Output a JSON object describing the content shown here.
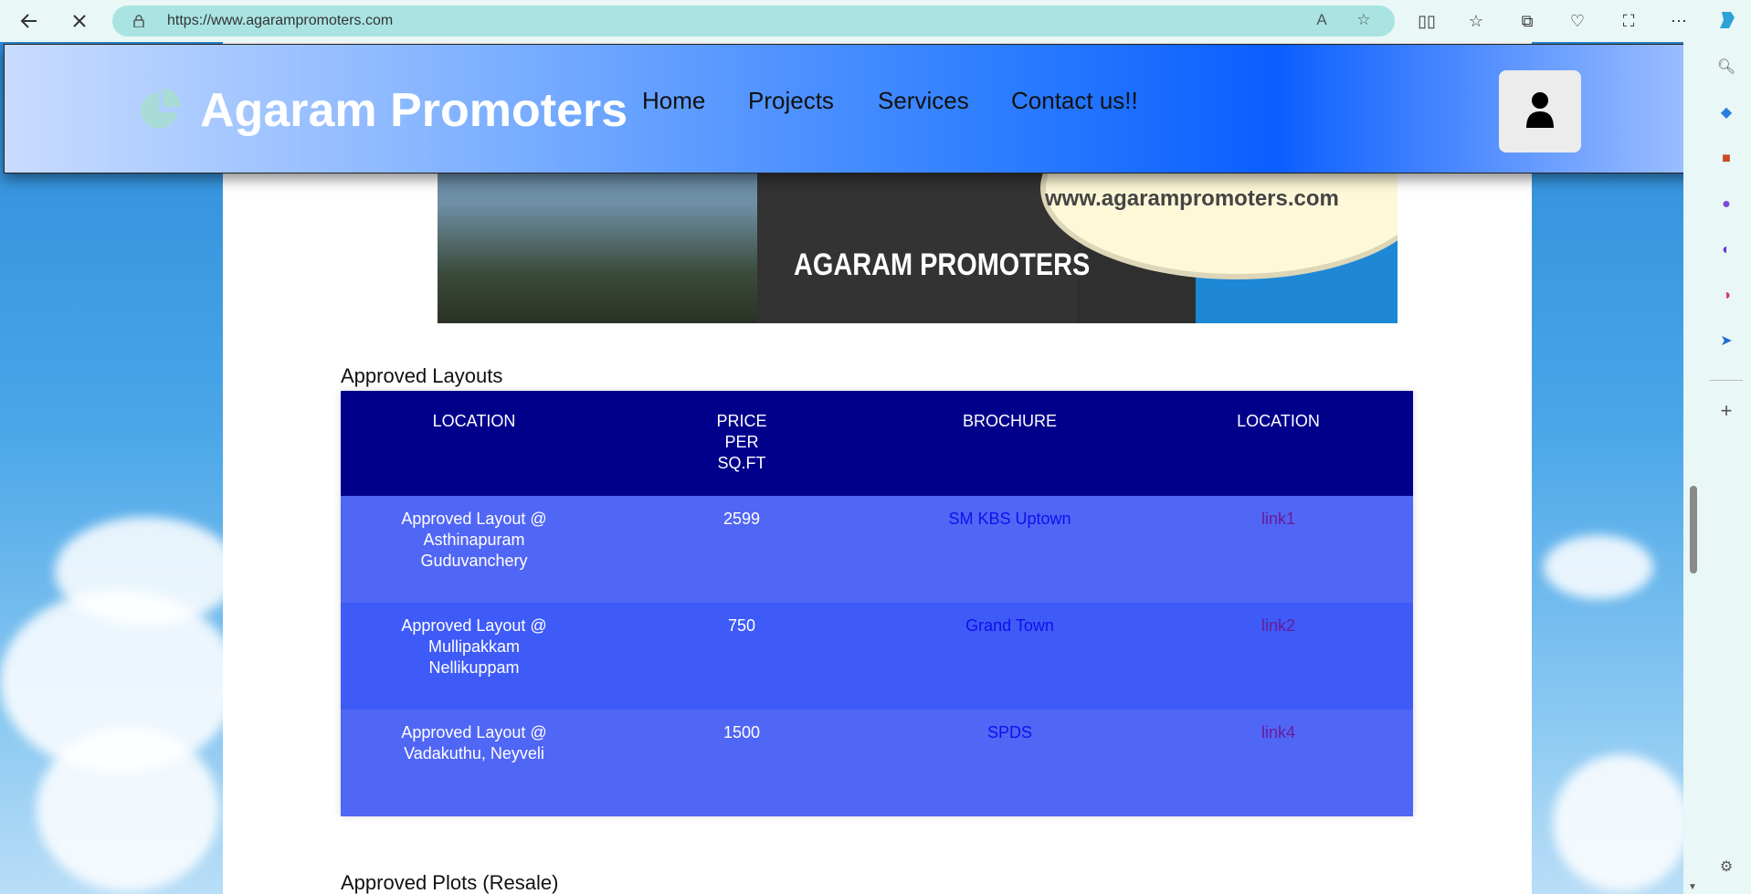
{
  "browser": {
    "url": "https://www.agarampromoters.com"
  },
  "header": {
    "logo_text": "Agaram Promoters",
    "nav": [
      "Home",
      "Projects",
      "Services",
      "Contact us!!"
    ]
  },
  "banner": {
    "site_text": "www.agarampromoters.com",
    "brand_text": "AGARAM PROMOTERS"
  },
  "approved_layouts": {
    "title": "Approved Layouts",
    "headers": [
      "LOCATION",
      "PRICE PER SQ.FT",
      "BROCHURE",
      "LOCATION"
    ],
    "rows": [
      {
        "location": "Approved Layout @ Asthinapuram Guduvanchery",
        "price": "2599",
        "brochure": "SM KBS Uptown",
        "link": "link1"
      },
      {
        "location": "Approved Layout @ Mullipakkam Nellikuppam",
        "price": "750",
        "brochure": "Grand Town",
        "link": "link2"
      },
      {
        "location": "Approved Layout @ Vadakuthu, Neyveli",
        "price": "1500",
        "brochure": "SPDS",
        "link": "link4"
      }
    ]
  },
  "approved_plots": {
    "title": "Approved Plots (Resale)"
  },
  "colors": {
    "table_header": "#00008b",
    "row_odd": "#5066f5",
    "row_even": "#3e5af7"
  }
}
